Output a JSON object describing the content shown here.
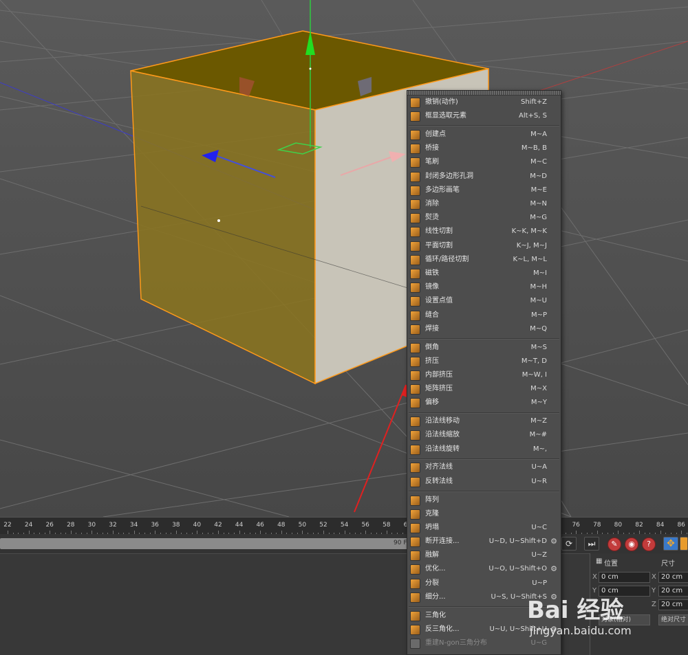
{
  "timeline": {
    "ticks": [
      "22",
      "24",
      "26",
      "28",
      "30",
      "32",
      "34",
      "36",
      "38",
      "40",
      "42",
      "44",
      "46",
      "48",
      "50",
      "52",
      "54",
      "56",
      "58",
      "60",
      "62",
      "64",
      "66",
      "68",
      "70",
      "72",
      "74",
      "76",
      "78",
      "80",
      "82",
      "84",
      "86"
    ]
  },
  "frame_bar": {
    "frame_label": "90 F"
  },
  "attributes": {
    "position_header": "位置",
    "size_header": "尺寸",
    "pos_x": "0 cm",
    "pos_y": "0 cm",
    "size_x": "20 cm",
    "size_y": "20 cm",
    "size_z": "20 cm",
    "axis_x": "X",
    "axis_y": "Y",
    "axis_z": "Z",
    "object_dropdown": "对象(相对)",
    "size_dropdown": "绝对尺寸"
  },
  "menu": {
    "groups": [
      [
        {
          "label": "撤销(动作)",
          "shortcut": "Shift+Z",
          "icon": "undo-icon"
        },
        {
          "label": "框显选取元素",
          "shortcut": "Alt+S, S",
          "icon": "frame-selection-icon"
        }
      ],
      [
        {
          "label": "创建点",
          "shortcut": "M~A",
          "icon": "create-point-icon"
        },
        {
          "label": "桥接",
          "shortcut": "M~B, B",
          "icon": "bridge-icon"
        },
        {
          "label": "笔刷",
          "shortcut": "M~C",
          "icon": "brush-icon"
        },
        {
          "label": "封闭多边形孔洞",
          "shortcut": "M~D",
          "icon": "close-hole-icon"
        },
        {
          "label": "多边形画笔",
          "shortcut": "M~E",
          "icon": "polygon-pen-icon"
        },
        {
          "label": "消除",
          "shortcut": "M~N",
          "icon": "dissolve-icon"
        },
        {
          "label": "熨烫",
          "shortcut": "M~G",
          "icon": "iron-icon"
        },
        {
          "label": "线性切割",
          "shortcut": "K~K, M~K",
          "icon": "line-cut-icon"
        },
        {
          "label": "平面切割",
          "shortcut": "K~J, M~J",
          "icon": "plane-cut-icon"
        },
        {
          "label": "循环/路径切割",
          "shortcut": "K~L, M~L",
          "icon": "loop-cut-icon"
        },
        {
          "label": "磁铁",
          "shortcut": "M~I",
          "icon": "magnet-icon"
        },
        {
          "label": "镜像",
          "shortcut": "M~H",
          "icon": "mirror-icon"
        },
        {
          "label": "设置点值",
          "shortcut": "M~U",
          "icon": "set-point-value-icon"
        },
        {
          "label": "缝合",
          "shortcut": "M~P",
          "icon": "stitch-icon"
        },
        {
          "label": "焊接",
          "shortcut": "M~Q",
          "icon": "weld-icon"
        }
      ],
      [
        {
          "label": "倒角",
          "shortcut": "M~S",
          "icon": "bevel-icon"
        },
        {
          "label": "挤压",
          "shortcut": "M~T, D",
          "icon": "extrude-icon"
        },
        {
          "label": "内部挤压",
          "shortcut": "M~W, I",
          "icon": "extrude-inner-icon"
        },
        {
          "label": "矩阵挤压",
          "shortcut": "M~X",
          "icon": "matrix-extrude-icon"
        },
        {
          "label": "偏移",
          "shortcut": "M~Y",
          "icon": "smooth-shift-icon"
        }
      ],
      [
        {
          "label": "沿法线移动",
          "shortcut": "M~Z",
          "icon": "normal-move-icon"
        },
        {
          "label": "沿法线缩放",
          "shortcut": "M~#",
          "icon": "normal-scale-icon"
        },
        {
          "label": "沿法线旋转",
          "shortcut": "M~,",
          "icon": "normal-rotate-icon"
        }
      ],
      [
        {
          "label": "对齐法线",
          "shortcut": "U~A",
          "icon": "align-normals-icon"
        },
        {
          "label": "反转法线",
          "shortcut": "U~R",
          "icon": "reverse-normals-icon"
        }
      ],
      [
        {
          "label": "阵列",
          "shortcut": "",
          "icon": "array-icon"
        },
        {
          "label": "克隆",
          "shortcut": "",
          "icon": "clone-icon"
        },
        {
          "label": "坍塌",
          "shortcut": "U~C",
          "icon": "collapse-icon"
        },
        {
          "label": "断开连接...",
          "shortcut": "U~D, U~Shift+D",
          "icon": "disconnect-icon",
          "gear": true
        },
        {
          "label": "融解",
          "shortcut": "U~Z",
          "icon": "melt-icon"
        },
        {
          "label": "优化...",
          "shortcut": "U~O, U~Shift+O",
          "icon": "optimize-icon",
          "gear": true
        },
        {
          "label": "分裂",
          "shortcut": "U~P",
          "icon": "split-icon"
        },
        {
          "label": "细分...",
          "shortcut": "U~S, U~Shift+S",
          "icon": "subdivide-icon",
          "gear": true
        }
      ],
      [
        {
          "label": "三角化",
          "shortcut": "",
          "icon": "triangulate-icon"
        },
        {
          "label": "反三角化...",
          "shortcut": "U~U, U~Shift+U",
          "icon": "untriangulate-icon",
          "gear": true
        },
        {
          "label": "重建N-gon三角分布",
          "shortcut": "U~G",
          "icon": "retriangulate-ngons-icon",
          "disabled": true
        }
      ]
    ]
  },
  "watermark": {
    "logo_text": "Bai 经验",
    "url": "jingyan.baidu.com"
  }
}
